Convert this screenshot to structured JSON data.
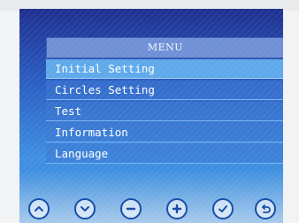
{
  "menu": {
    "title": "MENU",
    "items": [
      {
        "label": "Initial Setting",
        "selected": true
      },
      {
        "label": "Circles Setting",
        "selected": false
      },
      {
        "label": "Test",
        "selected": false
      },
      {
        "label": "Information",
        "selected": false
      },
      {
        "label": "Language",
        "selected": false
      }
    ]
  },
  "buttons": [
    {
      "icon": "up-arrow-icon"
    },
    {
      "icon": "down-arrow-icon"
    },
    {
      "icon": "minus-icon"
    },
    {
      "icon": "plus-icon"
    },
    {
      "icon": "check-icon"
    },
    {
      "icon": "back-icon"
    }
  ],
  "colors": {
    "screen_top": "#1e2f8f",
    "screen_bottom": "#3e8fe2",
    "header": "#6f8fd6",
    "selected_item": "#5ea9ea",
    "button_border": "#1a4fa8"
  }
}
